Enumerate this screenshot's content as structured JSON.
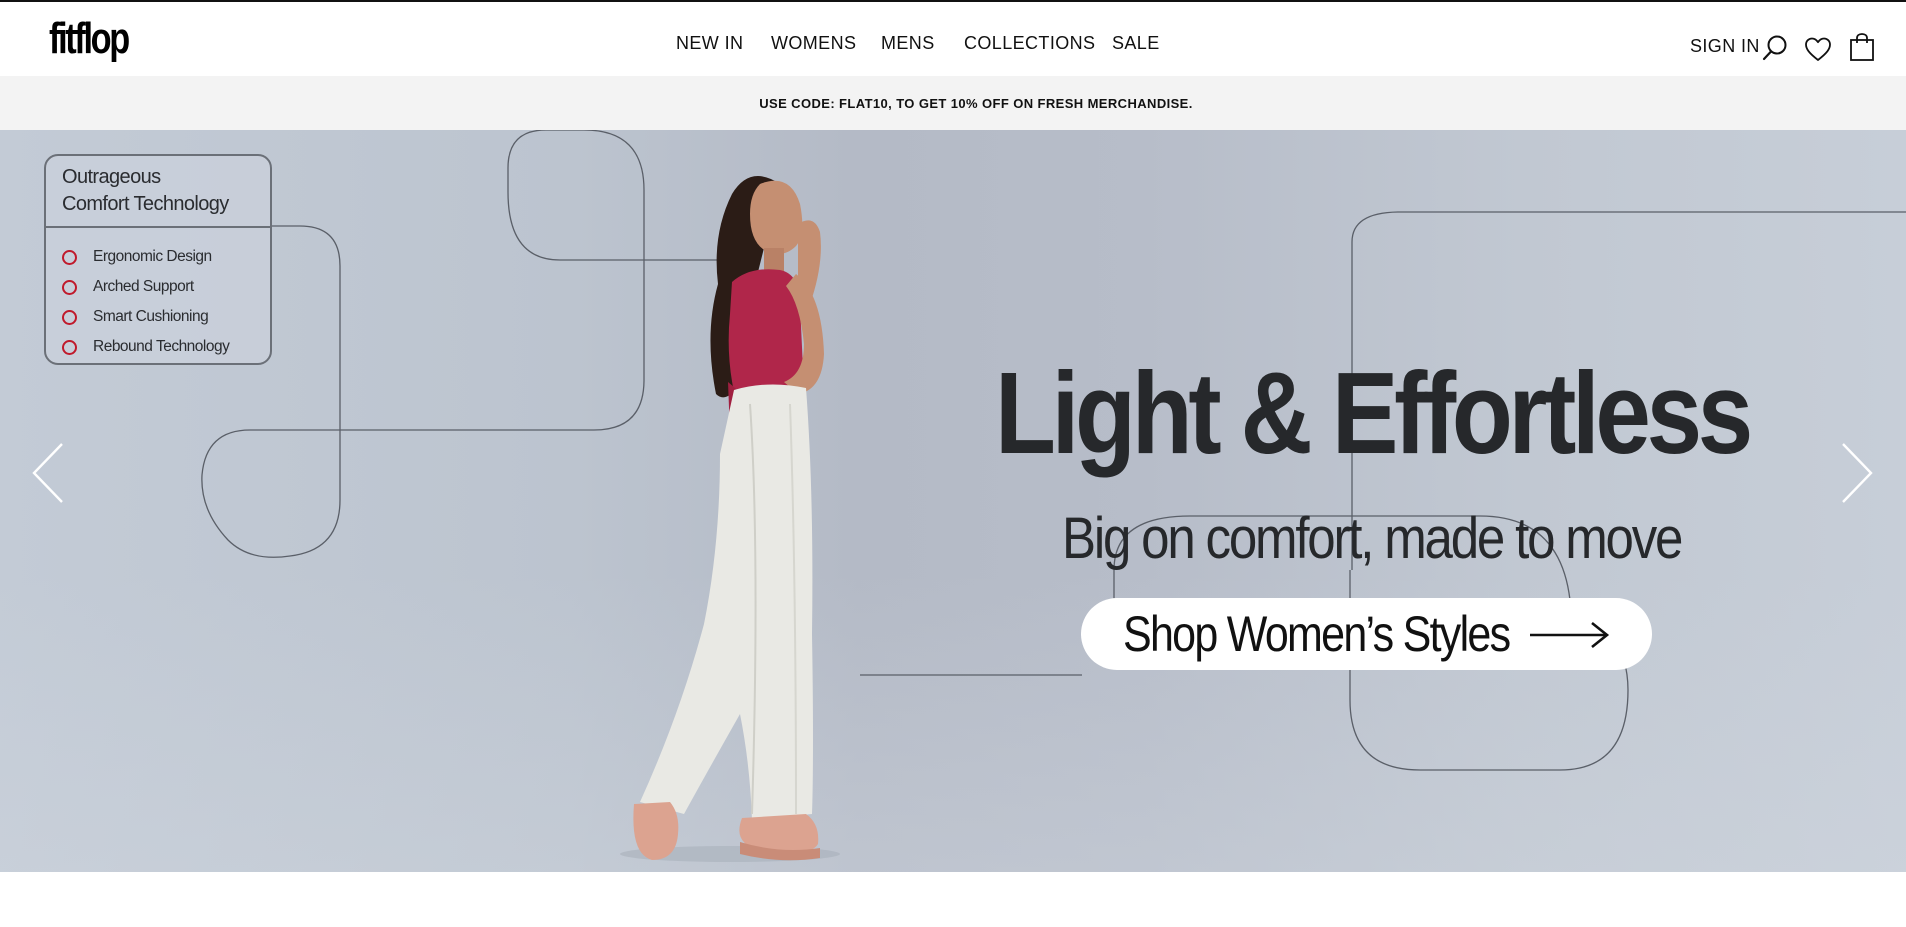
{
  "header": {
    "logo": "fitflop",
    "nav": [
      "NEW IN",
      "WOMENS",
      "MENS",
      "COLLECTIONS",
      "SALE"
    ],
    "sign_in": "SIGN IN",
    "icons": [
      "search-icon",
      "heart-icon",
      "shopping-bag-icon"
    ]
  },
  "promo": {
    "text": "USE CODE: FLAT10, TO GET 10% OFF ON FRESH MERCHANDISE."
  },
  "hero": {
    "tech_box": {
      "title_line1": "Outrageous",
      "title_line2": "Comfort Technology",
      "items": [
        "Ergonomic Design",
        "Arched Support",
        "Smart Cushioning",
        "Rebound Technology"
      ],
      "bullet_color": "#c01a2c"
    },
    "headline": "Light & Effortless",
    "subline": "Big on comfort, made to move",
    "cta": "Shop Women’s Styles",
    "icons": [
      "chevron-left-icon",
      "chevron-right-icon",
      "arrow-right-icon"
    ]
  },
  "colors": {
    "hero_background": "#bcc4cf",
    "headline": "#26282b",
    "promo_background": "#f3f3f3",
    "top_top_fill": "#b7c1d2",
    "top_color": "#b0264a"
  }
}
